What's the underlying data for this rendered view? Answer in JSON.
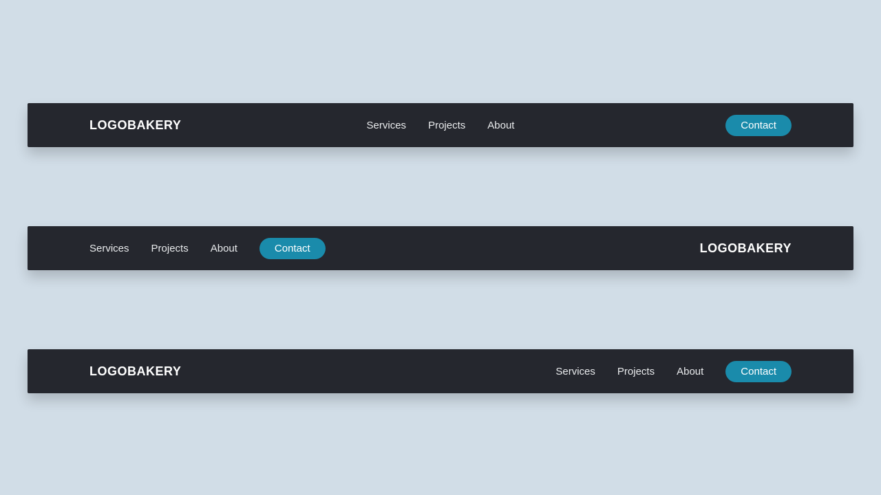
{
  "brand": "LOGOBAKERY",
  "nav": {
    "items": [
      "Services",
      "Projects",
      "About"
    ],
    "cta": "Contact"
  },
  "colors": {
    "background": "#d1dde7",
    "bar": "#25272e",
    "accent": "#1a8bab",
    "text": "#ffffff"
  }
}
